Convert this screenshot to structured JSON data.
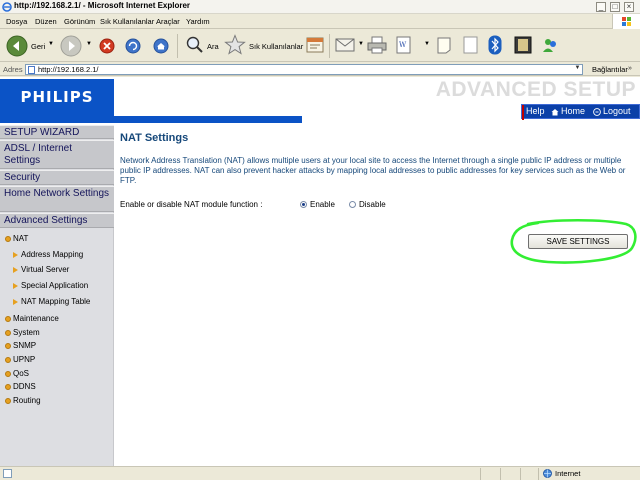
{
  "window": {
    "title": "http://192.168.2.1/ - Microsoft Internet Explorer",
    "buttons": [
      "_",
      "□",
      "×"
    ]
  },
  "menubar": [
    "Dosya",
    "Düzen",
    "Görünüm",
    "Sık Kullanılanlar",
    "Araçlar",
    "Yardım"
  ],
  "toolbar": {
    "back_label": "Geri",
    "search_label": "Ara",
    "favorites_label": "Sık Kullanılanlar"
  },
  "address": {
    "label": "Adres",
    "url": "http://192.168.2.1/",
    "links_label": "Bağlantılar"
  },
  "header": {
    "logo": "PHILIPS",
    "banner": "ADVANCED SETUP",
    "nav": {
      "help": "Help",
      "home": "Home",
      "logout": "Logout"
    }
  },
  "sidebar": {
    "sections": {
      "setup_wizard": "SETUP WIZARD",
      "adsl_internet": "ADSL / Internet Settings",
      "security": "Security",
      "home_network": "Home Network Settings",
      "advanced": "Advanced Settings"
    },
    "advanced_items": {
      "nat": "NAT",
      "nat_children": [
        "Address Mapping",
        "Virtual Server",
        "Special Application",
        "NAT Mapping Table"
      ],
      "others": [
        "Maintenance",
        "System",
        "SNMP",
        "UPNP",
        "QoS",
        "DDNS",
        "Routing"
      ]
    }
  },
  "main": {
    "title": "NAT Settings",
    "description": "Network Address Translation (NAT) allows multiple users at your local site to access the Internet through a single public IP address or multiple public IP addresses. NAT can also prevent hacker attacks by mapping local addresses to public addresses for key services such as the Web or FTP.",
    "option_label": "Enable or disable NAT module function :",
    "enable_label": "Enable",
    "disable_label": "Disable",
    "selected": "Enable",
    "save_label": "SAVE SETTINGS"
  },
  "status": {
    "zone": "Internet"
  },
  "colors": {
    "brand_blue": "#0b53c6",
    "title_text": "#16487a",
    "highlight": "#33ee33"
  }
}
